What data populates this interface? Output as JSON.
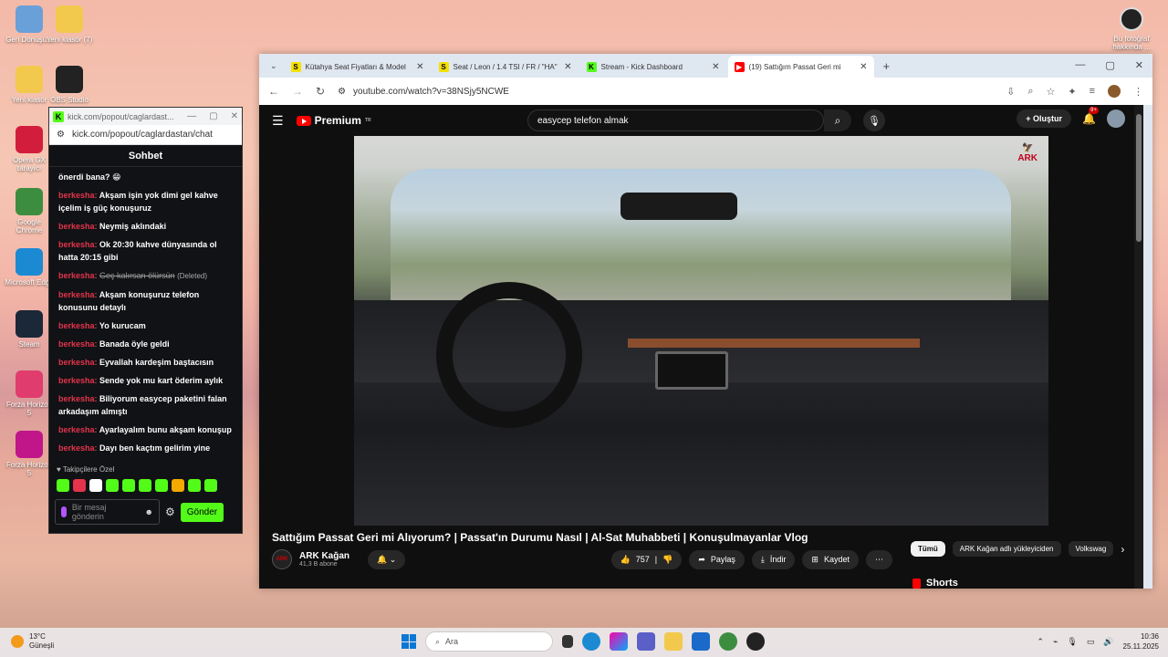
{
  "desktop": {
    "icons": [
      {
        "label": "Geri Dönüşü...",
        "icon": "recycle-bin-icon",
        "color": "#6aa0d8"
      },
      {
        "label": "Yeni klasör (7)",
        "icon": "folder-icon",
        "color": "#f2c94c"
      },
      {
        "label": "Yeni klasör",
        "icon": "folder-icon",
        "color": "#f2c94c"
      },
      {
        "label": "OBS Studio",
        "icon": "obs-icon",
        "color": "#222222"
      },
      {
        "label": "Opera GX tarayıcı",
        "icon": "opera-gx-icon",
        "color": "#d21e3c"
      },
      {
        "label": "Google Chrome",
        "icon": "chrome-icon",
        "color": "#3c8d40"
      },
      {
        "label": "Microsoft Edge",
        "icon": "edge-icon",
        "color": "#1b8ad3"
      },
      {
        "label": "Steam",
        "icon": "steam-icon",
        "color": "#1b2838"
      },
      {
        "label": "Forza Horizon 5",
        "icon": "forza-icon",
        "color": "#e03c6e"
      },
      {
        "label": "Forza Horizon 5",
        "icon": "forza-icon",
        "color": "#c0168a"
      }
    ],
    "photo_info": "Bu fotoğraf hakkında ..."
  },
  "chat": {
    "url_short": "kick.com/popout/caglardast...",
    "url": "kick.com/popout/caglardastan/chat",
    "header": "Sohbet",
    "first_line": "önerdi bana? 😁",
    "messages": [
      {
        "user": "berkesha:",
        "text": "Akşam işin yok dimi gel kahve içelim iş güç konuşuruz"
      },
      {
        "user": "berkesha:",
        "text": "Neymiş aklındaki"
      },
      {
        "user": "berkesha:",
        "text": "Ok 20:30 kahve dünyasında ol hatta 20:15 gibi"
      },
      {
        "user": "berkesha:",
        "text": "Geç kalırsan ölürsün",
        "deleted": "(Deleted)"
      },
      {
        "user": "berkesha:",
        "text": "Akşam konuşuruz telefon konusunu detaylı"
      },
      {
        "user": "berkesha:",
        "text": "Yo kurucam"
      },
      {
        "user": "berkesha:",
        "text": "Banada öyle geldi"
      },
      {
        "user": "berkesha:",
        "text": "Eyvallah kardeşim baştacısın"
      },
      {
        "user": "berkesha:",
        "text": "Sende yok mu kart öderim aylık"
      },
      {
        "user": "berkesha:",
        "text": "Biliyorum easycep paketini falan arkadaşım almıştı"
      },
      {
        "user": "berkesha:",
        "text": "Ayarlayalım bunu akşam konuşup"
      },
      {
        "user": "berkesha:",
        "text": "Dayı ben kaçtım gelirim yine"
      }
    ],
    "followers_label": "♥ Takipçilere Özel",
    "input_placeholder": "Bir mesaj gönderin",
    "send_label": "Gönder"
  },
  "browser": {
    "tabs": [
      {
        "title": "Kütahya Seat Fiyatları & Model",
        "fav": "S",
        "fav_color": "#f5e000"
      },
      {
        "title": "Seat / Leon / 1.4 TSI / FR / \"HA\"",
        "fav": "S",
        "fav_color": "#f5e000"
      },
      {
        "title": "Stream - Kick Dashboard",
        "fav": "K",
        "fav_color": "#53fc18"
      },
      {
        "title": "(19) Sattığım Passat Geri mi",
        "fav": "▶",
        "fav_color": "#ff0000",
        "active": true
      }
    ],
    "url": "youtube.com/watch?v=38NSjy5NCWE"
  },
  "youtube": {
    "logo": "Premium",
    "logo_sup": "TR",
    "search": "easycep telefon almak",
    "create": "Oluştur",
    "notif_badge": "9+",
    "video_logo": "ARK",
    "title": "Sattığım Passat Geri mi Alıyorum? | Passat'ın Durumu Nasıl | Al-Sat Muhabbeti | Konuşulmayanlar Vlog",
    "channel": "ARK Kağan",
    "subs": "41,3 B abone",
    "likes": "757",
    "share": "Paylaş",
    "download": "İndir",
    "save": "Kaydet",
    "chips": [
      "Tümü",
      "ARK Kağan adlı yükleyiciden",
      "Volkswag"
    ],
    "shorts": "Shorts"
  },
  "taskbar": {
    "temp": "13°C",
    "weather": "Güneşli",
    "search": "Ara",
    "time": "10:36",
    "date": "25.11.2025"
  }
}
